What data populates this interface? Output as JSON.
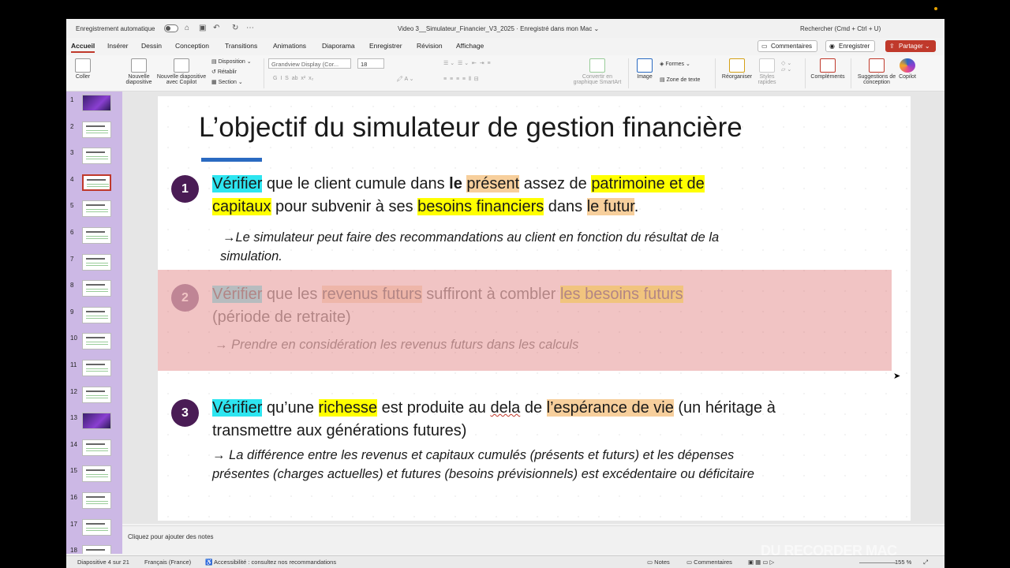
{
  "titlebar": {
    "autosave_label": "Enregistrement automatique",
    "doc_title": "Video 3__Simulateur_Financier_V3_2025  ·  Enregistré dans mon Mac ⌄",
    "search": "Rechercher (Cmd + Ctrl + U)"
  },
  "tabs": [
    "Accueil",
    "Insérer",
    "Dessin",
    "Conception",
    "Transitions",
    "Animations",
    "Diaporama",
    "Enregistrer",
    "Révision",
    "Affichage"
  ],
  "actions": {
    "comments": "Commentaires",
    "record": "Enregistrer",
    "share": "Partager"
  },
  "ribbon": {
    "paste": "Coller",
    "new_slide": "Nouvelle diapositive",
    "new_slide_copilot": "Nouvelle diapositive avec Copilot",
    "layout": "Disposition",
    "reset": "Rétablir",
    "section": "Section",
    "font": "Grandview Display (Cor...",
    "size": "18",
    "smartart": "Convertir en graphique SmartArt",
    "image": "Image",
    "shapes": "Formes",
    "textbox": "Zone de texte",
    "arrange": "Réorganiser",
    "quick_styles": "Styles rapides",
    "addins": "Compléments",
    "designer": "Suggestions de conception",
    "copilot": "Copilot"
  },
  "slides": [
    {
      "num": "1",
      "dark": true
    },
    {
      "num": "2"
    },
    {
      "num": "3"
    },
    {
      "num": "4",
      "selected": true
    },
    {
      "num": "5"
    },
    {
      "num": "6"
    },
    {
      "num": "7"
    },
    {
      "num": "8"
    },
    {
      "num": "9"
    },
    {
      "num": "10"
    },
    {
      "num": "11"
    },
    {
      "num": "12"
    },
    {
      "num": "13",
      "dark": true
    },
    {
      "num": "14"
    },
    {
      "num": "15"
    },
    {
      "num": "16"
    },
    {
      "num": "17"
    },
    {
      "num": "18"
    }
  ],
  "slide": {
    "title": "L’objectif du simulateur de gestion financière",
    "p1": {
      "num": "1",
      "verifier": "Vérifier",
      "t1": " que le client cumule dans ",
      "le": "le ",
      "present": "présent",
      "t2": " assez de ",
      "patrimoine": "patrimoine et de ",
      "capitaux": "capitaux",
      "t3": " pour subvenir à ses ",
      "besoins": "besoins financiers",
      "t4": " dans ",
      "futur": "le futur",
      "t5": ".",
      "note_a": "→Le simulateur peut faire des recommandations au client en fonction du résultat de la",
      "note_b": "simulation."
    },
    "p2": {
      "num": "2",
      "verifier": "Vérifier",
      "t1": " que les ",
      "revenus": "revenus futurs",
      "t2": " suffiront à combler ",
      "besoins": "les besoins futurs",
      "t3": "(période de retraite)",
      "note": "→ Prendre en considération les revenus futurs dans les calculs"
    },
    "p3": {
      "num": "3",
      "verifier": "Vérifier",
      "t1": " qu’une ",
      "richesse": "richesse",
      "t2": " est produite au ",
      "dela": "dela",
      "t3": " de ",
      "esperance": "l’espérance de vie",
      "t4": "  (un héritage à",
      "t5": "transmettre aux générations futures)",
      "note_a": "→ La différence entre les revenus et capitaux cumulés (présents et futurs)  et les  dépenses",
      "note_b": "présentes (charges actuelles) et futures (besoins prévisionnels) est excédentaire ou déficitaire"
    }
  },
  "notes_placeholder": "Cliquez pour ajouter des notes",
  "status": {
    "slide_count": "Diapositive 4 sur 21",
    "language": "Français (France)",
    "accessibility": "Accessibilité : consultez nos recommandations",
    "notes": "Notes",
    "comments": "Commentaires",
    "zoom": "155 %"
  },
  "watermark": "DU RECORDER MAC"
}
